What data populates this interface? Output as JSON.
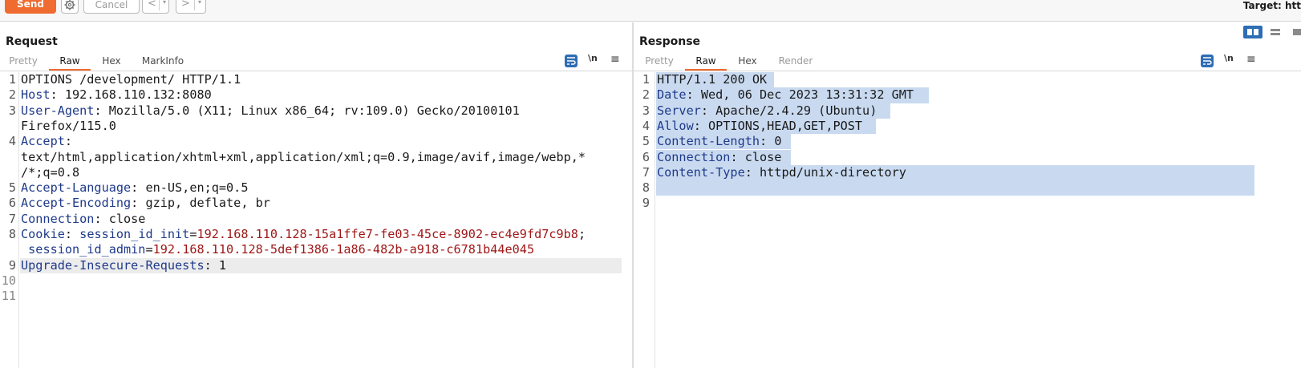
{
  "toolbar": {
    "send_label": "Send",
    "cancel_label": "Cancel",
    "back_glyph": "<",
    "forward_glyph": ">",
    "dropdown_glyph": "▾",
    "target_label": "Target: htt"
  },
  "colors": {
    "accent": "#ef6b30",
    "toggle_active": "#2e6db4",
    "header_name": "#1f3a8a",
    "cookie_value": "#a01818",
    "selection": "#c9daf0"
  },
  "request": {
    "title": "Request",
    "tabs": [
      "Pretty",
      "Raw",
      "Hex",
      "MarkInfo"
    ],
    "active_tab": "Raw",
    "icons": [
      "wrap-toggle-icon",
      "newline-toggle-icon",
      "menu-icon"
    ],
    "newline_glyph": "\\n",
    "menu_glyph": "≡",
    "line_numbers": [
      "1",
      "2",
      "3",
      "4",
      "5",
      "6",
      "7",
      "8",
      "9",
      "10",
      "11"
    ],
    "lines": {
      "l1": "OPTIONS /development/ HTTP/1.1",
      "l2_name": "Host",
      "l2_value": "192.168.110.132:8080",
      "l3_name": "User-Agent",
      "l3_value": "Mozilla/5.0 (X11; Linux x86_64; rv:109.0) Gecko/20100101",
      "l3_wrap": "Firefox/115.0",
      "l4_name": "Accept",
      "l4_wrap1": "text/html,application/xhtml+xml,application/xml;q=0.9,image/avif,image/webp,*",
      "l4_wrap2": "/*;q=0.8",
      "l5_name": "Accept-Language",
      "l5_value": "en-US,en;q=0.5",
      "l6_name": "Accept-Encoding",
      "l6_value": "gzip, deflate, br",
      "l7_name": "Connection",
      "l7_value": "close",
      "l8_name": "Cookie",
      "l8_c1_name": "session_id_init",
      "l8_c1_value": "192.168.110.128-15a1ffe7-fe03-45ce-8902-ec4e9fd7c9b8",
      "l8_c2_name": "session_id_admin",
      "l8_c2_value": "192.168.110.128-5def1386-1a86-482b-a918-c6781b44e045",
      "l9_name": "Upgrade-Insecure-Requests",
      "l9_value": "1"
    }
  },
  "response": {
    "title": "Response",
    "tabs": [
      "Pretty",
      "Raw",
      "Hex",
      "Render"
    ],
    "active_tab": "Raw",
    "icons": [
      "wrap-toggle-icon",
      "newline-toggle-icon",
      "menu-icon"
    ],
    "line_numbers": [
      "1",
      "2",
      "3",
      "4",
      "5",
      "6",
      "7",
      "8",
      "9"
    ],
    "lines": {
      "l1": "HTTP/1.1 200 OK",
      "l2_name": "Date",
      "l2_value": "Wed, 06 Dec 2023 13:31:32 GMT",
      "l3_name": "Server",
      "l3_value": "Apache/2.4.29 (Ubuntu)",
      "l4_name": "Allow",
      "l4_value": "OPTIONS,HEAD,GET,POST",
      "l5_name": "Content-Length",
      "l5_value": "0",
      "l6_name": "Connection",
      "l6_value": "close",
      "l7_name": "Content-Type",
      "l7_value": "httpd/unix-directory"
    }
  },
  "layout_toggles": [
    "split-horizontal-icon",
    "split-vertical-icon",
    "tabs-layout-icon"
  ],
  "separators": {
    "colon": ": ",
    "equals": "=",
    "semicolon": ";"
  }
}
